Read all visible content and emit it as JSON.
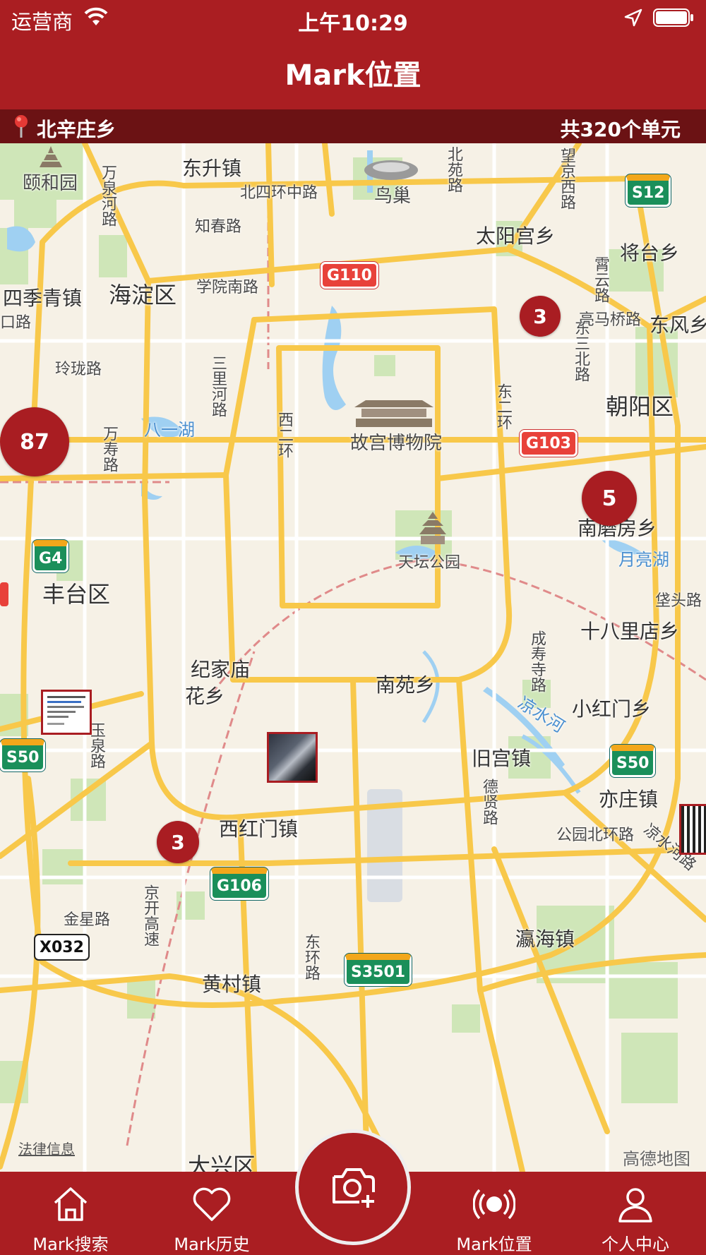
{
  "status_bar": {
    "carrier": "运营商",
    "time": "上午10:29"
  },
  "nav": {
    "title": "Mark位置"
  },
  "info_bar": {
    "location": "北辛庄乡",
    "unit_count": "共320个单元"
  },
  "map": {
    "labels": {
      "yiheyuan": "颐和园",
      "dongsheng": "东升镇",
      "beisihuan": "北四环中路",
      "niaochao": "鸟巢",
      "zhichun": "知春路",
      "taiyanggong": "太阳宫乡",
      "jiangtai": "将台乡",
      "haidian": "海淀区",
      "xueyuannan": "学院南路",
      "sijiqing": "四季青镇",
      "kouroad": "口路",
      "dongfeng": "东风乡",
      "linglong": "玲珑路",
      "chaoyang": "朝阳区",
      "gugong": "故宫博物院",
      "bayi": "八一湖",
      "nanmofang": "南磨房乡",
      "yueliang": "月亮湖",
      "tiantan": "天坛公园",
      "fengtai": "丰台区",
      "laotou": "垡头路",
      "shibali": "十八里店乡",
      "jijiamiao": "纪家庙",
      "huaxiang": "花乡",
      "nanyuan": "南苑乡",
      "xiaohongmen": "小红门乡",
      "jiugong": "旧宫镇",
      "yizhuang": "亦庄镇",
      "xihongmen": "西红门镇",
      "gongyuanbei": "公园北环路",
      "jinxing": "金星路",
      "yinghai": "瀛海镇",
      "huangcun": "黄村镇",
      "daxing": "大兴区",
      "wanquanhe": "万泉河路",
      "sanlihe": "三里河路",
      "xierhuan": "西二环",
      "donger": "东二环",
      "dongsanbei": "东三北路",
      "wangjingxi": "望京西路",
      "beiyuan": "北苑路",
      "xiaoyun": "霄云路",
      "liangma": "亮马桥路",
      "wanshou": "万寿路",
      "chengshou": "成寿寺路",
      "liangshui": "凉水河",
      "deshe": "德贤路",
      "dongtuan": "东环路",
      "jingkai": "京开高速",
      "yuquan": "玉泉路",
      "liangshuihelu": "凉水河路"
    },
    "shields": {
      "g110": "G110",
      "s12": "S12",
      "g103": "G103",
      "g4": "G4",
      "s50a": "S50",
      "s50b": "S50",
      "g106": "G106",
      "s3501": "S3501",
      "x032": "X032"
    },
    "clusters": {
      "c1": "3",
      "c2": "87",
      "c3": "5",
      "c4": "3"
    },
    "legal": "法律信息",
    "brand": "高德地图"
  },
  "tabs": {
    "search": "Mark搜索",
    "history": "Mark历史",
    "location": "Mark位置",
    "profile": "个人中心"
  }
}
